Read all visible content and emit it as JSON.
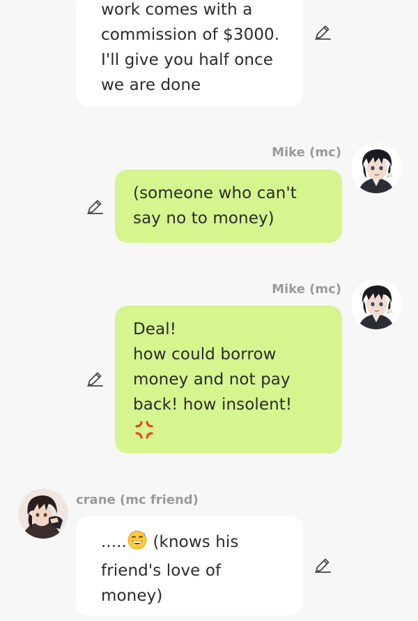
{
  "messages": [
    {
      "sender": "",
      "text": "work comes with a\ncommission of $3000.\nI'll give you half once\nwe are done"
    },
    {
      "sender": "Mike (mc)",
      "text": "(someone who can't\nsay no to money)"
    },
    {
      "sender": "Mike (mc)",
      "text": "Deal!\nhow could borrow\nmoney and not pay\nback! how insolent!",
      "emoji": "anger-symbol"
    },
    {
      "sender": "crane (mc friend)",
      "text_prefix": ".....",
      "emoji": "grinning-face-with-sweat",
      "text": " (knows his\nfriend's love of\nmoney)"
    }
  ],
  "colors": {
    "background": "#f7f7f7",
    "incoming_bubble": "#ffffff",
    "outgoing_bubble": "#d5f58f",
    "sender_label": "#9a9a9a",
    "text": "#2b2b2b"
  },
  "icons": {
    "edit": "pencil-edit-icon"
  }
}
